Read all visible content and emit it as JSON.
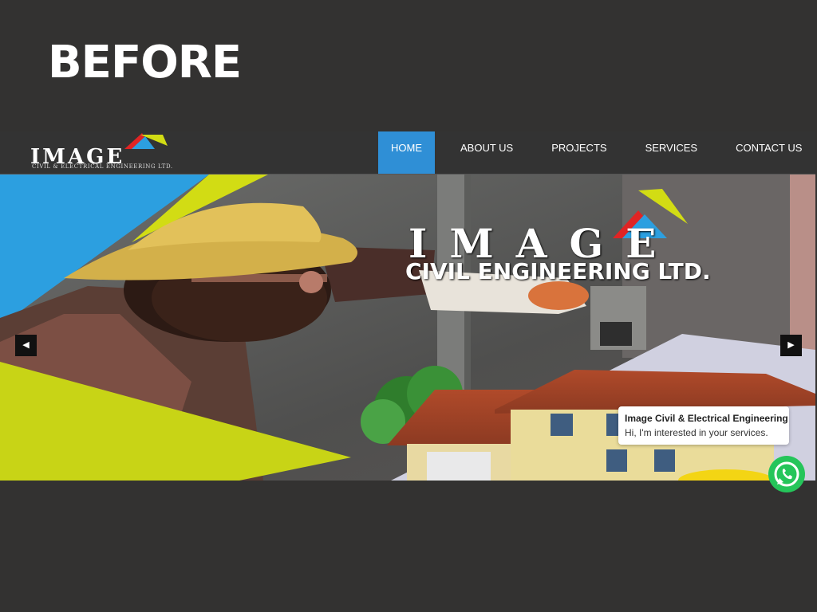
{
  "slide": {
    "title": "BEFORE"
  },
  "site": {
    "logo": {
      "text": "IMAGE",
      "tagline": "CIVIL & ELECTRICAL ENGINEERING LTD."
    },
    "nav": [
      {
        "label": "HOME",
        "active": true
      },
      {
        "label": "ABOUT US"
      },
      {
        "label": "PROJECTS"
      },
      {
        "label": "SERVICES"
      },
      {
        "label": "CONTACT US"
      }
    ],
    "hero": {
      "brand_title": "IMAGE",
      "brand_subtitle": "CIVIL ENGINEERING LTD.",
      "prev_icon": "triangle-left-icon",
      "next_icon": "triangle-right-icon"
    },
    "whatsapp": {
      "name": "Image Civil & Electrical Engineering",
      "message": "Hi, I'm interested in your services.",
      "icon": "whatsapp-icon"
    }
  },
  "colors": {
    "background": "#333231",
    "nav_active": "#2f8fd6",
    "accent_blue": "#2c9fe0",
    "accent_yellow": "#d2dc14",
    "accent_red": "#e02424",
    "whatsapp_green": "#25c55a"
  }
}
